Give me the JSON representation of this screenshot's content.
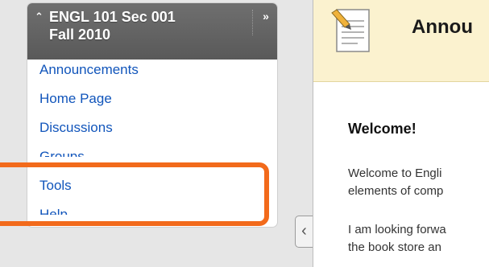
{
  "course_menu": {
    "title_line1": "ENGL 101 Sec 001",
    "title_line2": "Fall 2010",
    "items": [
      {
        "label": "Announcements"
      },
      {
        "label": "Home Page"
      },
      {
        "label": "Discussions"
      },
      {
        "label": "Groups"
      },
      {
        "label": "Tools"
      },
      {
        "label": "Help"
      }
    ]
  },
  "content": {
    "page_title": "Annou",
    "welcome_heading": "Welcome!",
    "paragraph1_line1": "Welcome to Engli",
    "paragraph1_line2": "elements of comp",
    "paragraph2_line1": "I am looking forwa",
    "paragraph2_line2": "the book store an"
  },
  "colors": {
    "menu_header": "#666666",
    "link": "#1155bb",
    "highlight": "#f26a1b",
    "page_header": "#fbf2cf"
  },
  "icons": [
    "collapse-up-icon",
    "double-chevron-right-icon",
    "document-pencil-icon",
    "chevron-left-icon"
  ]
}
